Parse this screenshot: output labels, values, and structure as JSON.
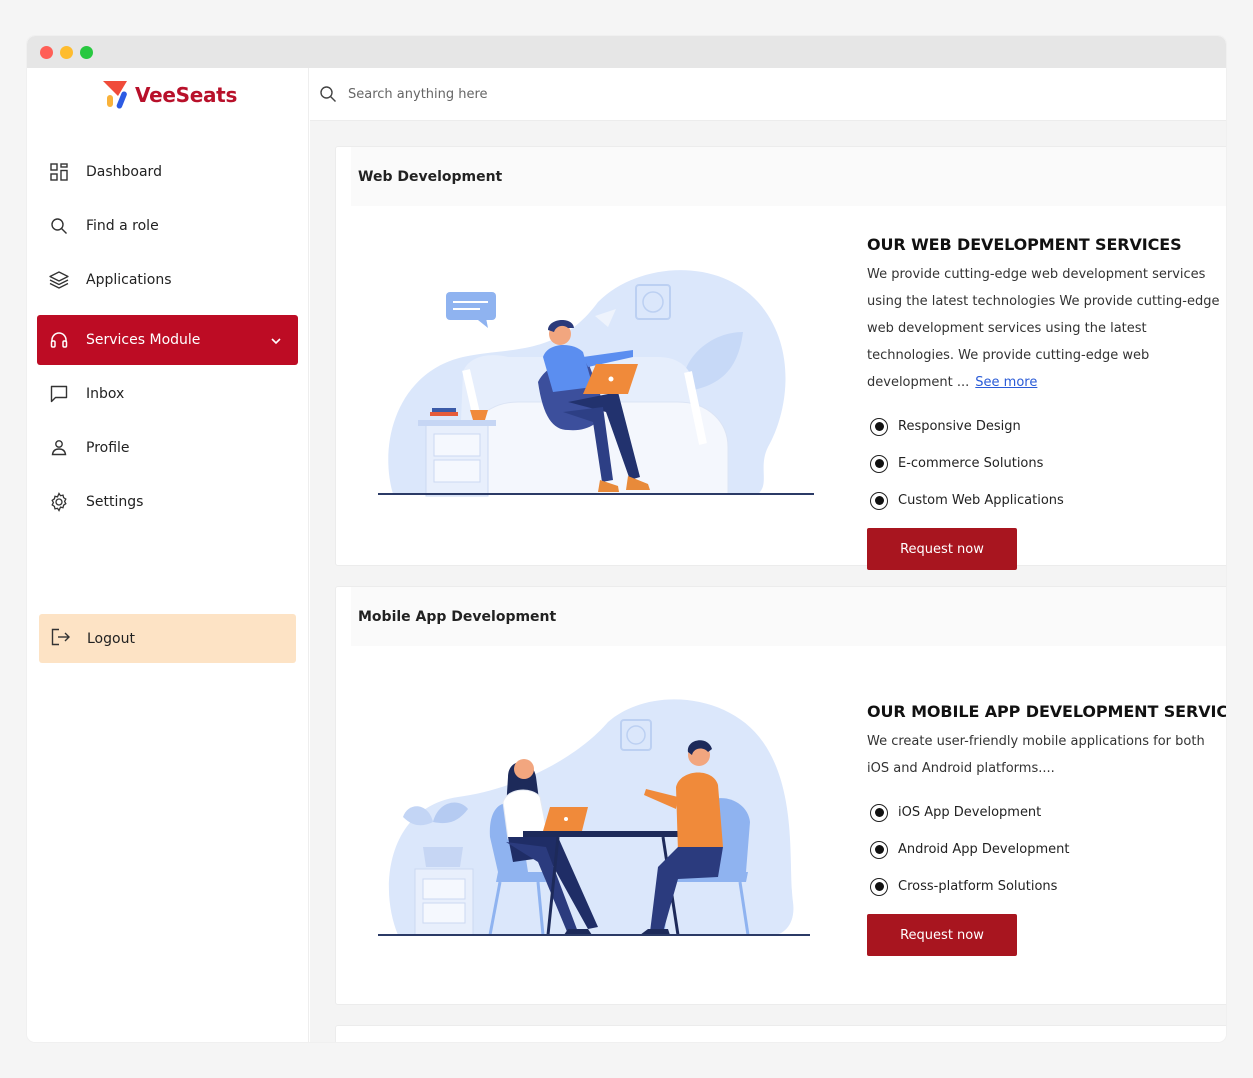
{
  "brand": {
    "name": "VeeSeats",
    "color": "#b8102a"
  },
  "sidebar": {
    "items": [
      {
        "label": "Dashboard",
        "icon": "grid-icon"
      },
      {
        "label": "Find a role",
        "icon": "search-icon"
      },
      {
        "label": "Applications",
        "icon": "layers-icon"
      },
      {
        "label": "Services Module",
        "icon": "headset-icon",
        "active": true
      },
      {
        "label": "Inbox",
        "icon": "message-icon"
      },
      {
        "label": "Profile",
        "icon": "user-icon"
      },
      {
        "label": "Settings",
        "icon": "gear-icon"
      }
    ],
    "logout_label": "Logout",
    "active_color": "#bd0c24",
    "logout_bg": "#fde3c5"
  },
  "search": {
    "placeholder": "Search anything here"
  },
  "services": [
    {
      "section_title": "Web Development",
      "heading": "OUR WEB DEVELOPMENT SERVICES",
      "description": "We provide cutting-edge web development services using the latest technologies We provide cutting-edge web development services using the latest technologies. We provide cutting-edge web development ...",
      "see_more": "See more",
      "features": [
        "Responsive Design",
        "E-commerce Solutions",
        "Custom Web Applications"
      ],
      "button_label": "Request now"
    },
    {
      "section_title": "Mobile App Development",
      "heading": "OUR MOBILE APP DEVELOPMENT SERVICES",
      "description": "We create user-friendly mobile applications for both iOS and Android platforms....",
      "features": [
        "iOS App Development",
        "Android App Development",
        "Cross-platform Solutions"
      ],
      "button_label": "Request now"
    }
  ],
  "colors": {
    "button": "#a8151f",
    "illustration_blue": "#dbe7fb"
  }
}
